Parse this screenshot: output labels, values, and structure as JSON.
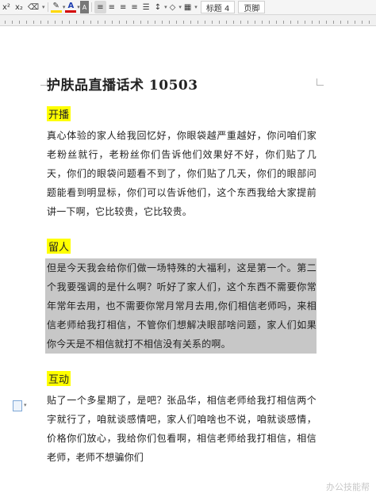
{
  "toolbar": {
    "style_name": "标题 4",
    "style_name2": "页脚"
  },
  "document": {
    "title": "护肤品直播话术 10503",
    "sections": [
      {
        "heading": "开播",
        "text": "真心体验的家人给我回忆好，你眼袋越严重越好，你问咱们家老粉丝就行，老粉丝你们告诉他们效果好不好，你们贴了几天，你们的眼袋问题看不到了，你们贴了几天，你们的眼部问题能看到明显标，你们可以告诉他们，这个东西我给大家提前讲一下啊，它比较贵，它比较贵。"
      },
      {
        "heading": "留人",
        "text": "但是今天我会给你们做一场特殊的大福利，这是第一个。第二个我要强调的是什么啊？听好了家人们，这个东西不需要你常年常年去用，也不需要你常月常月去用,你们相信老师吗，来相信老师给我打相信，不管你们想解决眼部啥问题，家人们如果你今天是不相信就打不相信没有关系的啊。"
      },
      {
        "heading": "互动",
        "text": "贴了一个多星期了，是吧？张品华，相信老师给我打相信两个字就行了，咱就谈感情吧，家人们咱啥也不说，咱就谈感情，价格你们放心，我给你们包看啊，相信老师给我打相信，相信老师，老师不想骗你们"
      }
    ]
  },
  "watermark": "办公技能帮"
}
